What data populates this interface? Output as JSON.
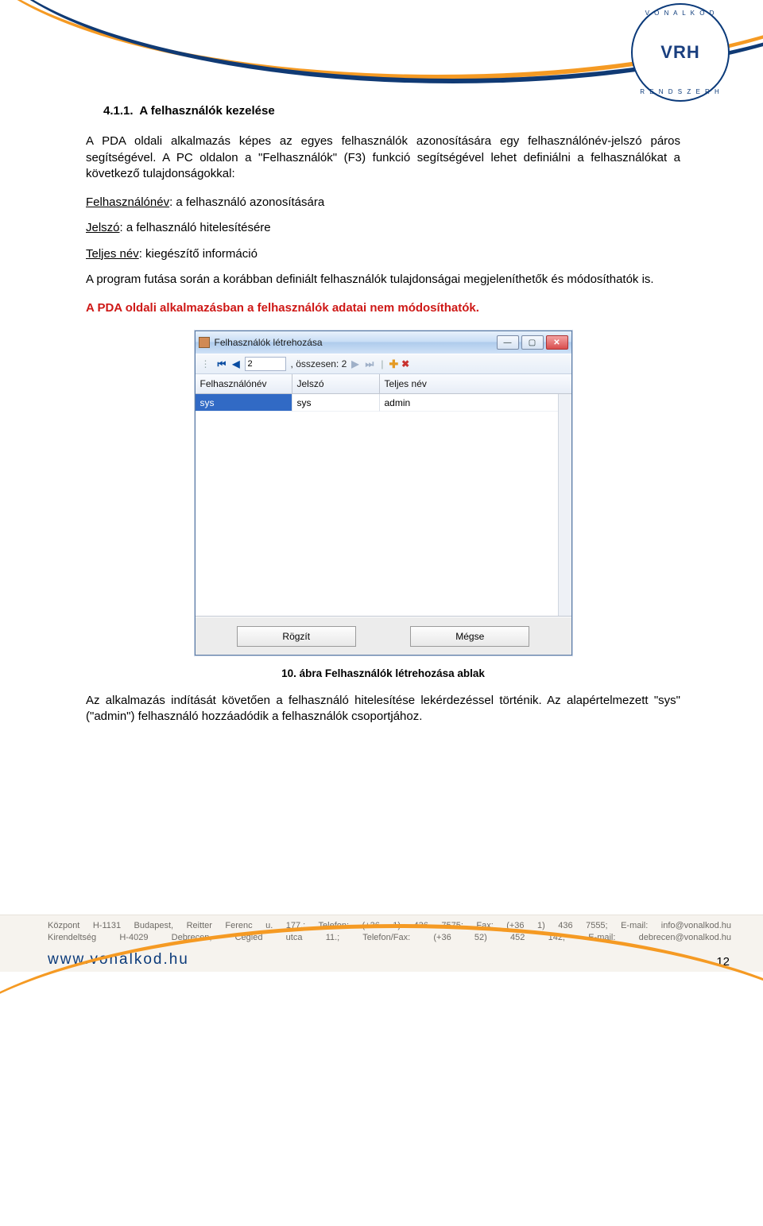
{
  "header": {
    "logo_main": "VRH",
    "logo_top": "V O N A L K Ó D",
    "logo_bottom": "R E N D S Z E R H"
  },
  "section": {
    "number": "4.1.1.",
    "title": "A felhasználók kezelése"
  },
  "p1": "A PDA oldali alkalmazás képes az egyes felhasználók azonosítására egy felhasználónév-jelszó páros segítségével. A PC oldalon a \"Felhasználók\" (F3) funkció segítségével lehet definiálni a felhasználókat a következő tulajdonságokkal:",
  "defs": {
    "fname_l": "Felhasználónév",
    "fname_v": ": a felhasználó azonosítására",
    "pw_l": "Jelszó",
    "pw_v": ": a felhasználó hitelesítésére",
    "full_l": "Teljes név",
    "full_v": ": kiegészítő információ"
  },
  "p2": "A program futása során a korábban definiált felhasználók tulajdonságai megjeleníthetők és módosíthatók is.",
  "warn": "A PDA oldali alkalmazásban a felhasználók adatai nem módosíthatók.",
  "window": {
    "title": "Felhasználók létrehozása",
    "pos": "2",
    "total_label": ", összesen: 2",
    "columns": {
      "c1": "Felhasználónév",
      "c2": "Jelszó",
      "c3": "Teljes név"
    },
    "row": {
      "c1": "sys",
      "c2": "sys",
      "c3": "admin"
    },
    "btn_save": "Rögzít",
    "btn_cancel": "Mégse"
  },
  "caption": "10. ábra Felhasználók létrehozása ablak",
  "p3": "Az alkalmazás indítását követően a felhasználó hitelesítése lekérdezéssel történik. Az alapértelmezett \"sys\" (\"admin\") felhasználó hozzáadódik a felhasználók csoportjához.",
  "footer": {
    "line1": "Központ H-1131 Budapest, Reitter Ferenc u. 177.; Telefon: (+36 1) 436 7575; Fax: (+36 1) 436 7555; E-mail: info@vonalkod.hu",
    "line2": "Kirendeltség   H-4029  Debrecen,  Cegléd  utca  11.;   Telefon/Fax:   (+36  52)   452  142;   E-mail:   debrecen@vonalkod.hu",
    "site": "www.vonalkod.hu",
    "pagenum": "12"
  }
}
